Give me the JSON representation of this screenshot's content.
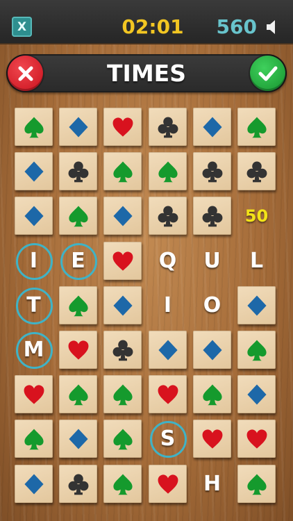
{
  "topbar": {
    "exit_label": "X",
    "timer": "02:01",
    "score": "560"
  },
  "wordbar": {
    "current_word": "TIMES"
  },
  "colors": {
    "spade": "#159a2d",
    "diamond": "#1d68a8",
    "heart": "#d8121e",
    "club": "#333333",
    "timer": "#f2c622",
    "score": "#68c4cc",
    "selection_ring": "#3fb3c6",
    "points": "#f2e318"
  },
  "board": {
    "rows": [
      [
        {
          "t": "spade"
        },
        {
          "t": "diamond"
        },
        {
          "t": "heart"
        },
        {
          "t": "club"
        },
        {
          "t": "diamond"
        },
        {
          "t": "spade"
        }
      ],
      [
        {
          "t": "diamond"
        },
        {
          "t": "club"
        },
        {
          "t": "spade"
        },
        {
          "t": "spade"
        },
        {
          "t": "club"
        },
        {
          "t": "club"
        }
      ],
      [
        {
          "t": "diamond"
        },
        {
          "t": "spade"
        },
        {
          "t": "diamond"
        },
        {
          "t": "club"
        },
        {
          "t": "club"
        },
        {
          "t": "points",
          "v": "50"
        }
      ],
      [
        {
          "t": "letter",
          "v": "I",
          "selected": true
        },
        {
          "t": "letter",
          "v": "E",
          "selected": true
        },
        {
          "t": "heart"
        },
        {
          "t": "letter",
          "v": "Q"
        },
        {
          "t": "letter",
          "v": "U"
        },
        {
          "t": "letter",
          "v": "L"
        }
      ],
      [
        {
          "t": "letter",
          "v": "T",
          "selected": true
        },
        {
          "t": "spade"
        },
        {
          "t": "diamond"
        },
        {
          "t": "letter",
          "v": "I"
        },
        {
          "t": "letter",
          "v": "O"
        },
        {
          "t": "diamond"
        }
      ],
      [
        {
          "t": "letter",
          "v": "M",
          "selected": true
        },
        {
          "t": "heart"
        },
        {
          "t": "club"
        },
        {
          "t": "diamond"
        },
        {
          "t": "diamond"
        },
        {
          "t": "spade"
        }
      ],
      [
        {
          "t": "heart"
        },
        {
          "t": "spade"
        },
        {
          "t": "spade"
        },
        {
          "t": "heart"
        },
        {
          "t": "spade"
        },
        {
          "t": "diamond"
        }
      ],
      [
        {
          "t": "spade"
        },
        {
          "t": "diamond"
        },
        {
          "t": "spade"
        },
        {
          "t": "letter",
          "v": "S",
          "selected": true
        },
        {
          "t": "heart"
        },
        {
          "t": "heart"
        }
      ],
      [
        {
          "t": "diamond"
        },
        {
          "t": "club"
        },
        {
          "t": "spade"
        },
        {
          "t": "heart"
        },
        {
          "t": "letter",
          "v": "H"
        },
        {
          "t": "spade"
        }
      ]
    ]
  }
}
